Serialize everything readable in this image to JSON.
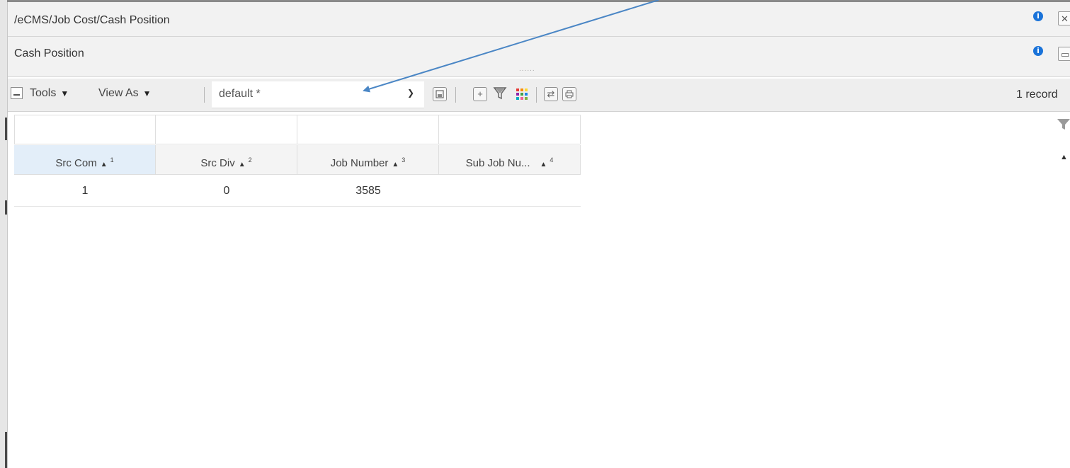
{
  "breadcrumb": {
    "path": "/eCMS/Job Cost/Cash Position"
  },
  "panel": {
    "title": "Cash Position",
    "grip": "......"
  },
  "toolbar": {
    "tools_label": "Tools",
    "view_as_label": "View As",
    "view_select_value": "default *",
    "record_count": "1 record"
  },
  "grid": {
    "columns": [
      {
        "label": "Src Com",
        "sort_order": "1"
      },
      {
        "label": "Src Div",
        "sort_order": "2"
      },
      {
        "label": "Job Number",
        "sort_order": "3"
      },
      {
        "label": "Sub Job Nu...",
        "sort_order": "4"
      }
    ],
    "rows": [
      [
        "1",
        "0",
        "3585",
        ""
      ]
    ]
  },
  "icons": {
    "info": "info-icon",
    "close": "close-icon",
    "restore": "restore-icon",
    "collapse": "collapse-icon",
    "save": "save-icon",
    "add": "add-icon",
    "filter": "filter-icon",
    "colorize": "color-grid-icon",
    "refresh": "refresh-icon",
    "print": "print-icon"
  },
  "colors": {
    "accent_blue": "#1a73d9",
    "annotation_arrow": "#4a86c5",
    "selected_header": "#e3eef9"
  }
}
